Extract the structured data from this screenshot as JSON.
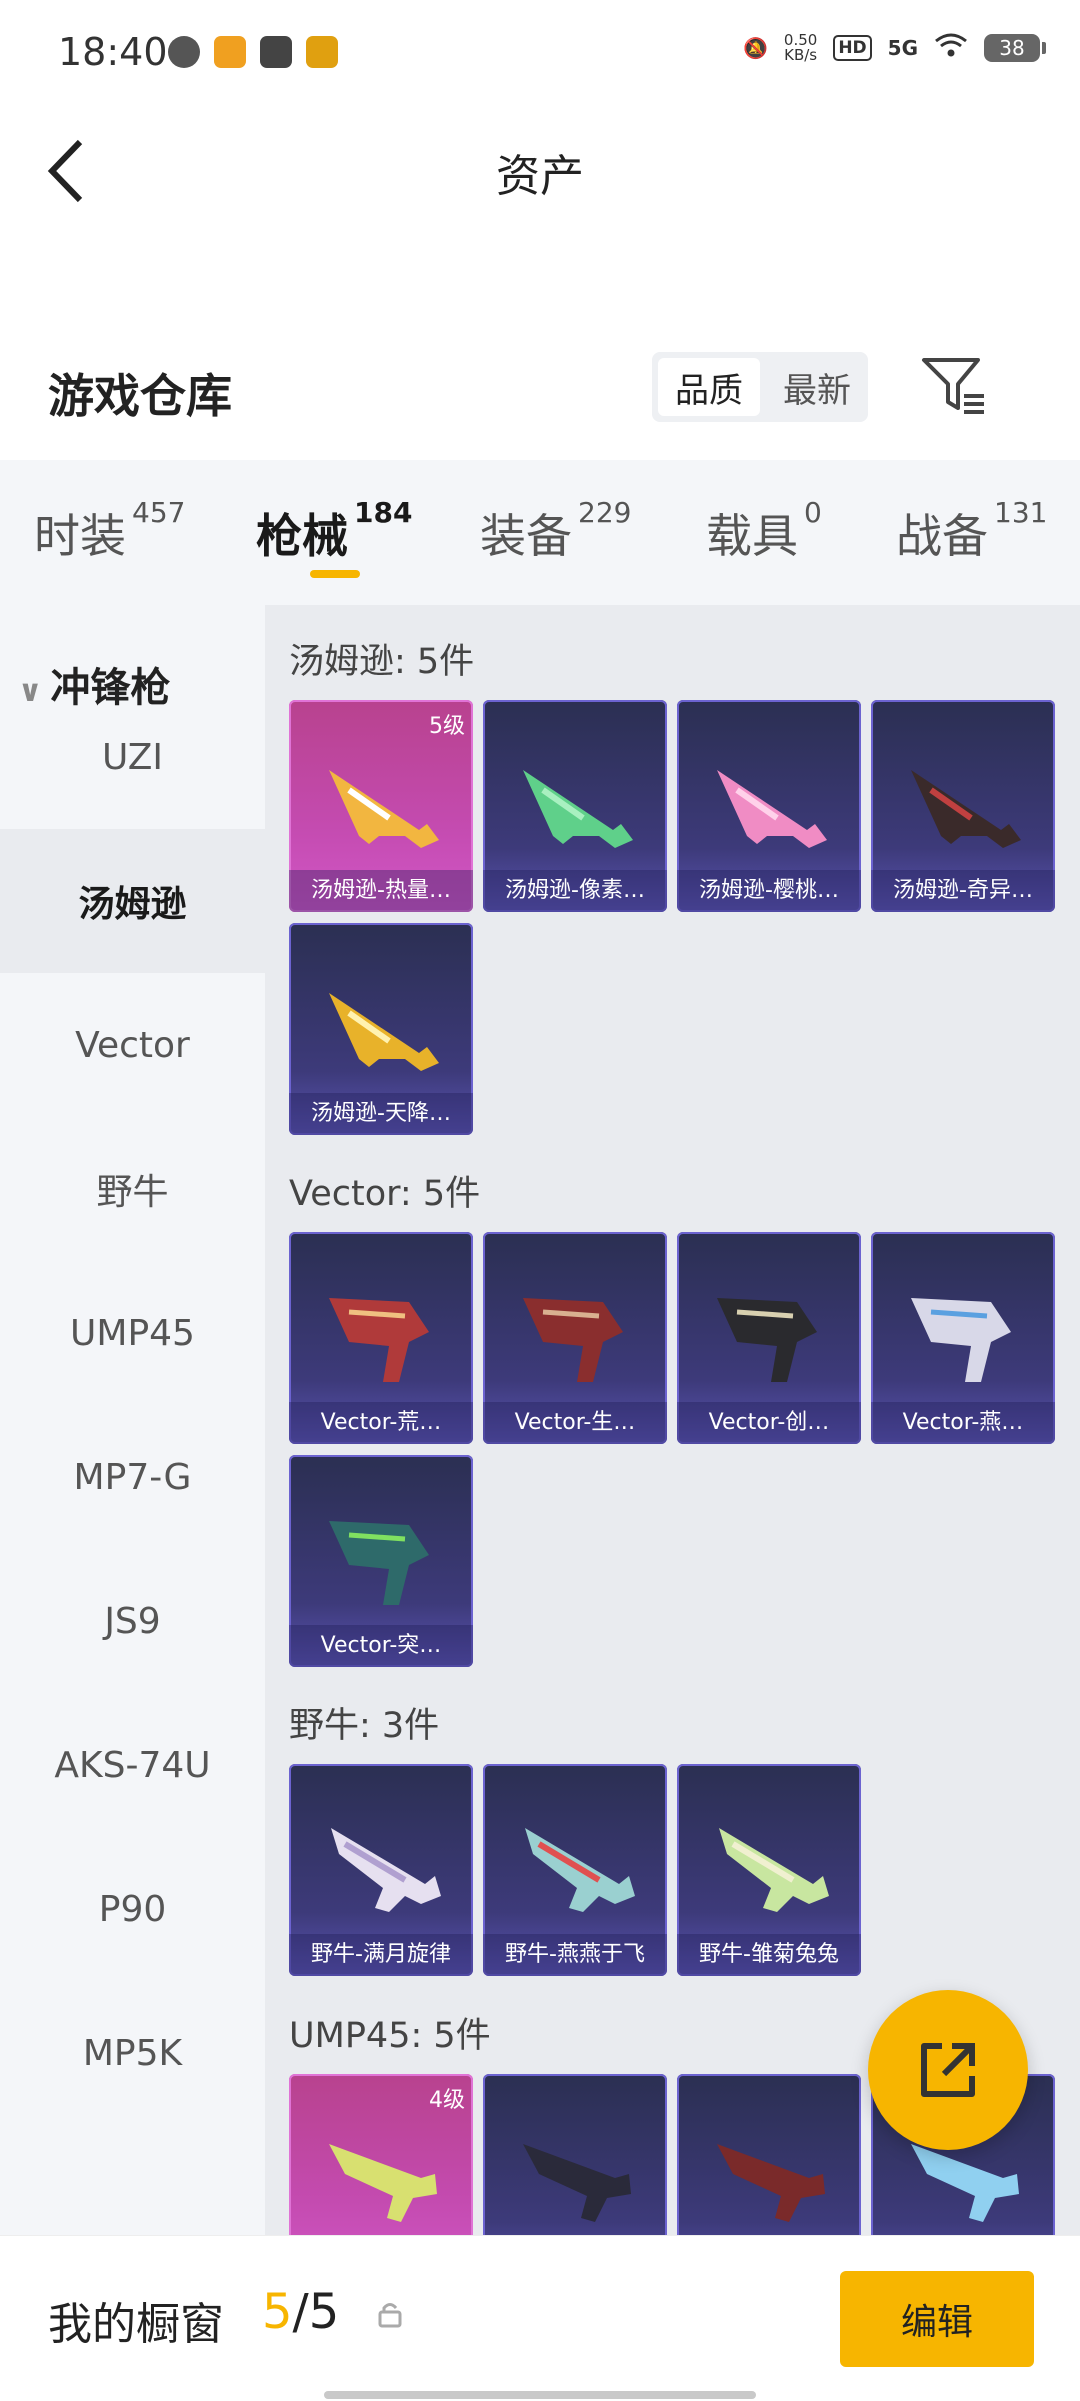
{
  "status": {
    "time": "18:40",
    "net_speed": "0.50",
    "net_unit": "KB/s",
    "hd": "HD",
    "signal": "5G",
    "battery": "38"
  },
  "header": {
    "title": "资产"
  },
  "warehouse": {
    "title": "游戏仓库",
    "sort_options": [
      "品质",
      "最新"
    ],
    "sort_active": "品质"
  },
  "tabs": [
    {
      "label": "时装",
      "count": "457"
    },
    {
      "label": "枪械",
      "count": "184"
    },
    {
      "label": "装备",
      "count": "229"
    },
    {
      "label": "载具",
      "count": "0"
    },
    {
      "label": "战备",
      "count": "131"
    }
  ],
  "sidebar": {
    "category": "冲锋枪",
    "items": [
      "UZI",
      "汤姆逊",
      "Vector",
      "野牛",
      "UMP45",
      "MP7-G",
      "JS9",
      "AKS-74U",
      "P90",
      "MP5K"
    ],
    "active": "汤姆逊"
  },
  "groups": [
    {
      "title": "汤姆逊: 5件",
      "items": [
        {
          "label": "汤姆逊-热量…",
          "badge": "5级",
          "color": "pink"
        },
        {
          "label": "汤姆逊-像素…",
          "color": "purple"
        },
        {
          "label": "汤姆逊-樱桃…",
          "color": "purple"
        },
        {
          "label": "汤姆逊-奇异…",
          "color": "purple"
        },
        {
          "label": "汤姆逊-天降…",
          "color": "purple"
        }
      ]
    },
    {
      "title": "Vector: 5件",
      "items": [
        {
          "label": "Vector-荒…",
          "color": "purple"
        },
        {
          "label": "Vector-生…",
          "color": "purple"
        },
        {
          "label": "Vector-创…",
          "color": "purple"
        },
        {
          "label": "Vector-燕…",
          "color": "purple"
        },
        {
          "label": "Vector-突…",
          "color": "purple"
        }
      ]
    },
    {
      "title": "野牛: 3件",
      "items": [
        {
          "label": "野牛-满月旋律",
          "color": "purple"
        },
        {
          "label": "野牛-燕燕于飞",
          "color": "purple"
        },
        {
          "label": "野牛-雏菊兔兔",
          "color": "purple"
        }
      ]
    },
    {
      "title": "UMP45: 5件",
      "items": [
        {
          "label": "",
          "badge": "4级",
          "color": "pink"
        },
        {
          "label": "",
          "color": "purple"
        },
        {
          "label": "",
          "color": "purple"
        },
        {
          "label": "",
          "color": "purple"
        }
      ]
    }
  ],
  "footer": {
    "label": "我的橱窗",
    "count_used": "5",
    "count_sep": "/5",
    "edit_label": "编辑"
  },
  "colors": {
    "accent": "#f7b500",
    "pink_card": "#c44bb0",
    "purple_card": "#3d3a7a"
  }
}
